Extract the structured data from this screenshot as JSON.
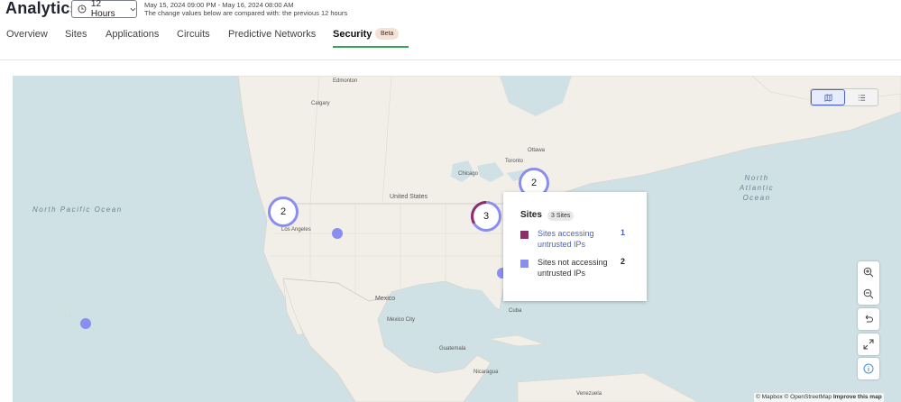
{
  "header": {
    "title": "Analytics",
    "time_range_label": "12 Hours",
    "date_range": "May 15, 2024 09:00 PM - May 16, 2024 08:00 AM",
    "comparison_note": "The change values below are compared with: the previous 12 hours"
  },
  "tabs": [
    {
      "label": "Overview"
    },
    {
      "label": "Sites"
    },
    {
      "label": "Applications"
    },
    {
      "label": "Circuits"
    },
    {
      "label": "Predictive Networks"
    },
    {
      "label": "Security",
      "active": true,
      "badge": "Beta"
    }
  ],
  "map": {
    "oceans": [
      "North Pacific Ocean",
      "North Atlantic Ocean"
    ],
    "places": [
      "Edmonton",
      "Calgary",
      "Ottawa",
      "Toronto",
      "Chicago",
      "United States",
      "Los Angeles",
      "Mexico",
      "Mexico City",
      "Cuba",
      "Guatemala",
      "Nicaragua",
      "Venezuela"
    ],
    "clusters": [
      {
        "count": "2",
        "style": "purple"
      },
      {
        "count": "2",
        "style": "purple"
      },
      {
        "count": "3",
        "style": "mixed"
      }
    ],
    "colors": {
      "water": "#cfe1e5",
      "land": "#f2efe9",
      "accessing_untrusted": "#8e2e6a",
      "not_accessing_untrusted": "#8a8ef0"
    }
  },
  "popup": {
    "title": "Sites",
    "count_badge": "3 Sites",
    "rows": [
      {
        "label": "Sites accessing untrusted IPs",
        "value": "1",
        "color": "#8e2e6a",
        "link": true
      },
      {
        "label": "Sites not accessing untrusted IPs",
        "value": "2",
        "color": "#8a8ef0",
        "link": false
      }
    ]
  },
  "controls": {
    "icons": [
      "map-view-icon",
      "list-view-icon",
      "zoom-in-icon",
      "zoom-out-icon",
      "reset-icon",
      "fullscreen-icon",
      "info-icon"
    ]
  },
  "attribution": {
    "mapbox": "© Mapbox",
    "osm": "© OpenStreetMap",
    "improve": "Improve this map"
  }
}
